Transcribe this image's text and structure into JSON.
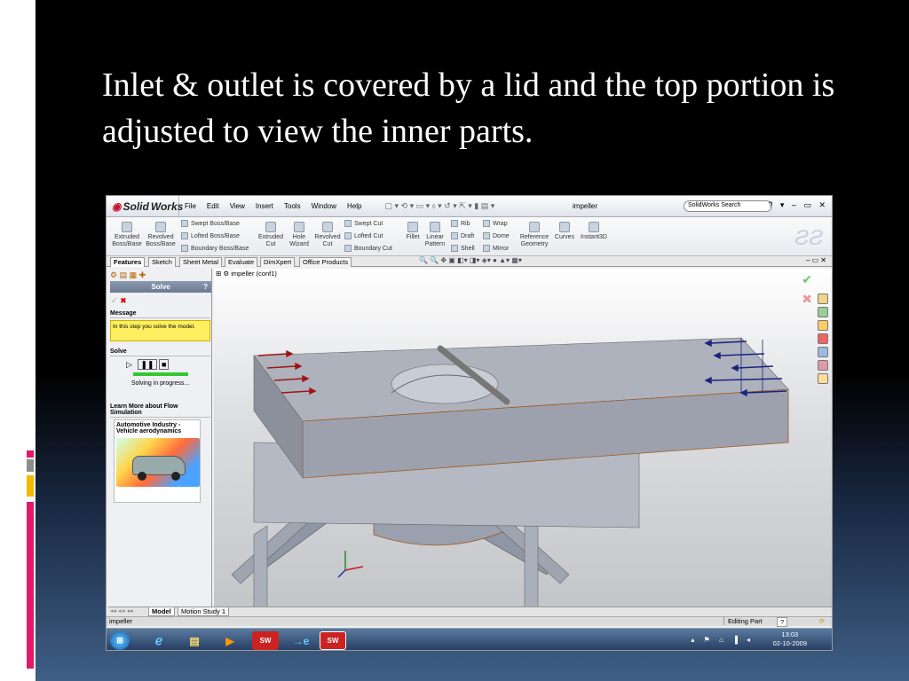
{
  "slide": {
    "title": "Inlet & outlet is covered by a lid and the top portion is adjusted to view the inner parts.",
    "colors": {
      "background": "#000000",
      "accent_red": "#e0196a",
      "accent_gold": "#f5b800",
      "accent_gray": "#8c8c8c"
    }
  },
  "app": {
    "logo_prefix": "Solid",
    "logo_suffix": "Works",
    "menu": [
      "File",
      "Edit",
      "View",
      "Insert",
      "Tools",
      "Window",
      "Help"
    ],
    "document_name": "impeller",
    "search_placeholder": "SolidWorks Search",
    "window_controls": "? ▾ – ▭ ✕"
  },
  "command_manager": {
    "extruded_boss": "Extruded Boss/Base",
    "revolved_boss": "Revolved Boss/Base",
    "swept_boss": "Swept Boss/Base",
    "lofted_boss": "Lofted Boss/Base",
    "boundary_boss": "Boundary Boss/Base",
    "extruded_cut": "Extruded Cut",
    "hole_wizard": "Hole Wizard",
    "revolved_cut": "Revolved Cut",
    "swept_cut": "Swept Cut",
    "lofted_cut": "Lofted Cut",
    "boundary_cut": "Boundary Cut",
    "fillet": "Fillet",
    "linear_pattern": "Linear Pattern",
    "rib": "Rib",
    "draft": "Draft",
    "shell": "Shell",
    "wrap": "Wrap",
    "dome": "Dome",
    "mirror": "Mirror",
    "reference_geometry": "Reference Geometry",
    "curves": "Curves",
    "instant3d": "Instant3D"
  },
  "tabs": [
    "Features",
    "Sketch",
    "Sheet Metal",
    "Evaluate",
    "DimXpert",
    "Office Products"
  ],
  "property_manager": {
    "title": "Solve",
    "help": "?",
    "message_header": "Message",
    "message_text": "In this step you solve the model.",
    "solve_header": "Solve",
    "progress_text": "Solving in progress...",
    "progress_fraction": 1.0,
    "learn_header": "Learn More about Flow Simulation",
    "card_title": "Automotive Industry - Vehicle aerodynamics"
  },
  "feature_tree": {
    "root": "impeller  (conf1)"
  },
  "bottom_tabs": [
    "Model",
    "Motion Study 1"
  ],
  "status_bar": {
    "left": "impeller",
    "mode": "Editing Part"
  },
  "taskbar": {
    "apps": [
      "start-orb",
      "internet-explorer",
      "file-explorer",
      "media-player",
      "solidworks",
      "ie-arrow",
      "solidworks-active"
    ],
    "time": "13:03",
    "date": "02-10-2009"
  }
}
